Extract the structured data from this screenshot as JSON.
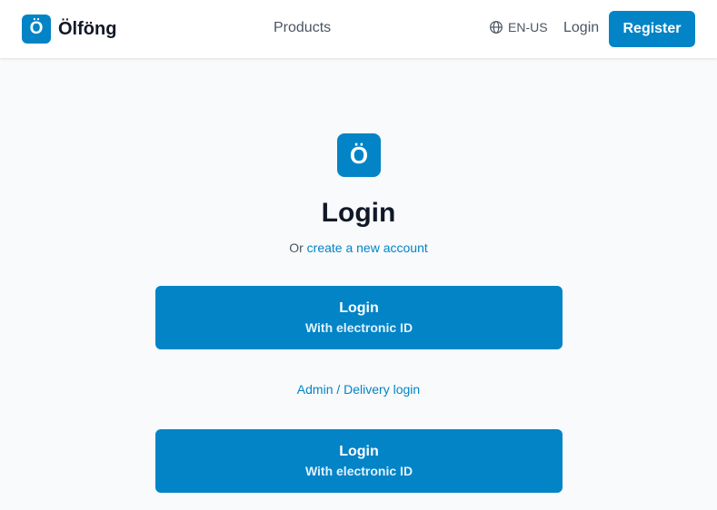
{
  "brand": {
    "logo_letter": "Ö",
    "name": "Ölföng"
  },
  "nav": {
    "products": "Products",
    "language": "EN-US",
    "login": "Login",
    "register": "Register"
  },
  "main": {
    "logo_letter": "Ö",
    "title": "Login",
    "subtitle_prefix": "Or",
    "create_account": "create a new account",
    "primary_button": {
      "label": "Login",
      "sublabel": "With electronic ID"
    },
    "admin_link": "Admin / Delivery login",
    "secondary_button": {
      "label": "Login",
      "sublabel": "With electronic ID"
    }
  },
  "icons": {
    "language": "globe-icon"
  },
  "colors": {
    "accent": "#0284c7",
    "text": "#111827",
    "muted": "#4b5563",
    "background": "#f9fafb"
  }
}
